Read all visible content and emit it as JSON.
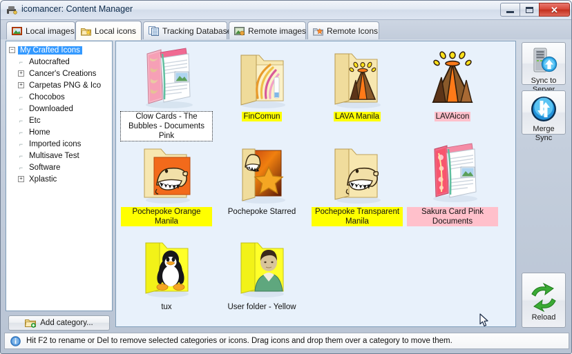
{
  "window": {
    "title": "icomancer: Content Manager",
    "icon": "app-icon",
    "controls": {
      "minimize": "–",
      "maximize": "□",
      "close": "✕"
    }
  },
  "tabs": [
    {
      "label": "Local images",
      "icon": "picture-icon",
      "active": false
    },
    {
      "label": "Local icons",
      "icon": "folder-star-icon",
      "active": true
    },
    {
      "label": "Tracking Database",
      "icon": "database-icon",
      "active": false
    },
    {
      "label": "Remote images",
      "icon": "remote-picture-icon",
      "active": false
    },
    {
      "label": "Remote Icons",
      "icon": "remote-star-icon",
      "active": false
    }
  ],
  "tree": {
    "nodes": [
      {
        "label": "My Crafted Icons",
        "level": 0,
        "expander": "minus",
        "selected": true
      },
      {
        "label": "Autocrafted",
        "level": 1,
        "expander": "none",
        "selected": false
      },
      {
        "label": "Cancer's Creations",
        "level": 1,
        "expander": "plus",
        "selected": false
      },
      {
        "label": "Carpetas PNG & Ico",
        "level": 1,
        "expander": "plus",
        "selected": false
      },
      {
        "label": "Chocobos",
        "level": 1,
        "expander": "none",
        "selected": false
      },
      {
        "label": "Downloaded",
        "level": 1,
        "expander": "none",
        "selected": false
      },
      {
        "label": "Etc",
        "level": 1,
        "expander": "none",
        "selected": false
      },
      {
        "label": "Home",
        "level": 1,
        "expander": "none",
        "selected": false
      },
      {
        "label": "Imported icons",
        "level": 1,
        "expander": "none",
        "selected": false
      },
      {
        "label": "Multisave Test",
        "level": 1,
        "expander": "none",
        "selected": false
      },
      {
        "label": "Software",
        "level": 1,
        "expander": "none",
        "selected": false
      },
      {
        "label": "Xplastic",
        "level": 1,
        "expander": "plus",
        "selected": false
      }
    ],
    "add_category_label": "Add category...",
    "add_category_icon": "folder-add-icon"
  },
  "icons": [
    {
      "label": "Clow Cards - The Bubbles - Documents Pink",
      "art": "pink-documents-folder",
      "highlight": "none",
      "selected": true
    },
    {
      "label": "FinComun",
      "art": "manila-swoosh-folder",
      "highlight": "yellow",
      "selected": false
    },
    {
      "label": "LAVA Manila",
      "art": "manila-volcano-folder",
      "highlight": "yellow",
      "selected": false
    },
    {
      "label": "LAVAicon",
      "art": "volcano-icon",
      "highlight": "pink",
      "selected": false
    },
    {
      "label": "Pochepoke Orange Manila",
      "art": "pochepoke-orange-folder",
      "highlight": "yellow",
      "selected": false
    },
    {
      "label": "Pochepoke Starred",
      "art": "pochepoke-star-folder",
      "highlight": "none",
      "selected": false
    },
    {
      "label": "Pochepoke Transparent Manila",
      "art": "pochepoke-manila-folder",
      "highlight": "yellow",
      "selected": false
    },
    {
      "label": "Sakura Card Pink Documents",
      "art": "sakura-documents-folder",
      "highlight": "pink",
      "selected": false
    },
    {
      "label": "tux",
      "art": "tux-yellow-folder",
      "highlight": "none",
      "selected": false
    },
    {
      "label": "User folder - Yellow",
      "art": "user-yellow-folder",
      "highlight": "none",
      "selected": false
    }
  ],
  "commands": [
    {
      "label": "Sync to\nServer",
      "line1": "Sync to",
      "line2": "Server",
      "icon": "server-upload-icon"
    },
    {
      "label": "Merge\nSync",
      "line1": "Merge",
      "line2": "Sync",
      "icon": "merge-sync-icon"
    },
    {
      "label": "Reload",
      "line1": "Reload",
      "line2": "",
      "icon": "reload-icon"
    }
  ],
  "status": {
    "icon": "info-icon",
    "text": "Hit F2 to rename or Del to remove selected categories or icons. Drag icons and drop them over a category to move them."
  },
  "colors": {
    "highlight_yellow": "#ffff00",
    "highlight_pink": "#ffc0cb",
    "selection_blue": "#3399ff",
    "list_background": "#e8f1fb",
    "window_chrome": "#c5cfdd"
  }
}
